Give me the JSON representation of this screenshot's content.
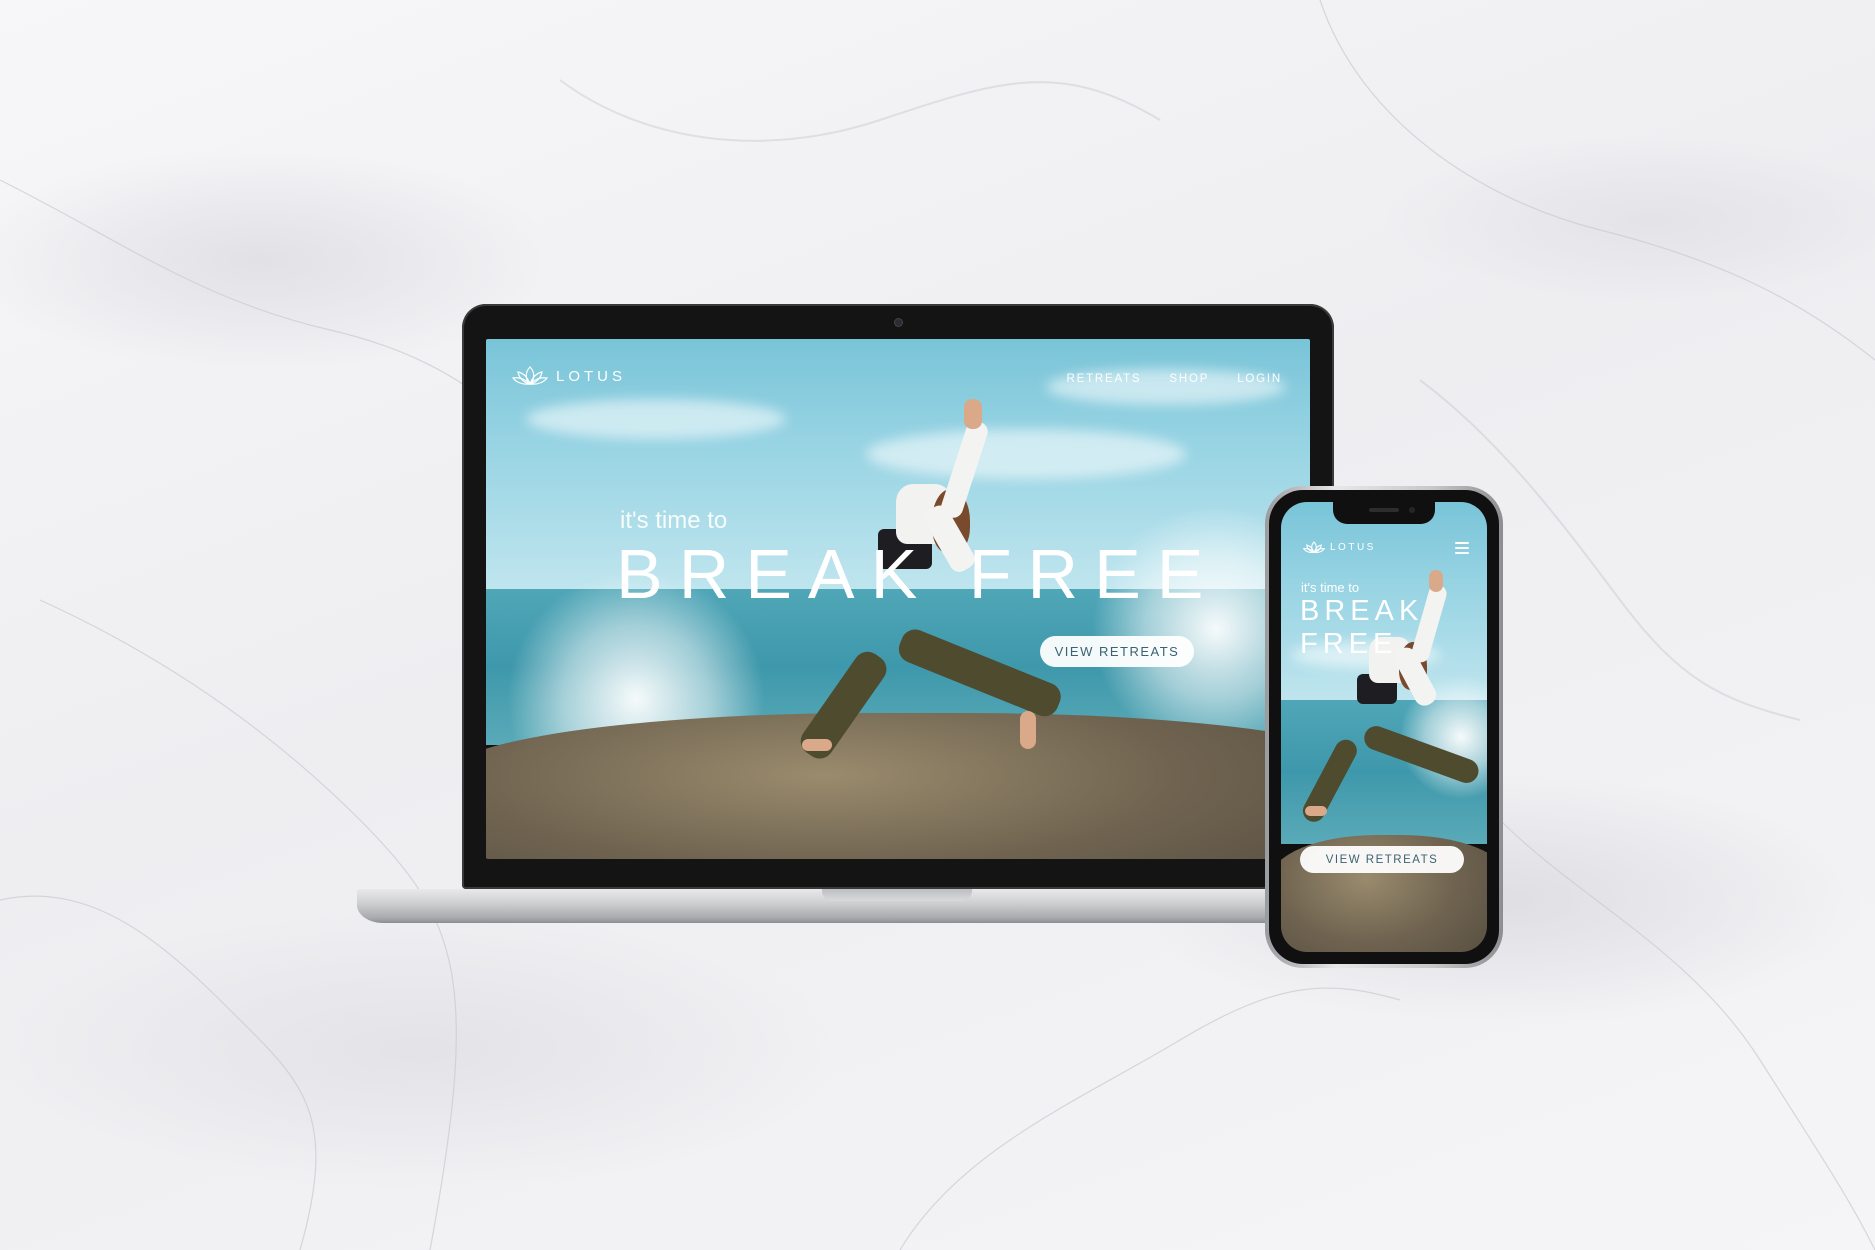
{
  "brand": {
    "name": "LOTUS"
  },
  "desktop": {
    "nav": [
      "RETREATS",
      "SHOP",
      "LOGIN"
    ],
    "hero_subtitle": "it's time to",
    "hero_title": "BREAK FREE",
    "cta_label": "VIEW RETREATS"
  },
  "mobile": {
    "brand": "LOTUS",
    "hero_subtitle": "it's time to",
    "hero_title_line1": "BREAK",
    "hero_title_line2": "FREE",
    "cta_label": "VIEW RETREATS"
  },
  "colors": {
    "sky": "#8fcfe0",
    "sea": "#3e98ab",
    "button_text": "#3b6272",
    "background": "#f2f2f4"
  },
  "icons": [
    "lotus-logo-icon",
    "camera-icon",
    "hamburger-menu-icon"
  ]
}
